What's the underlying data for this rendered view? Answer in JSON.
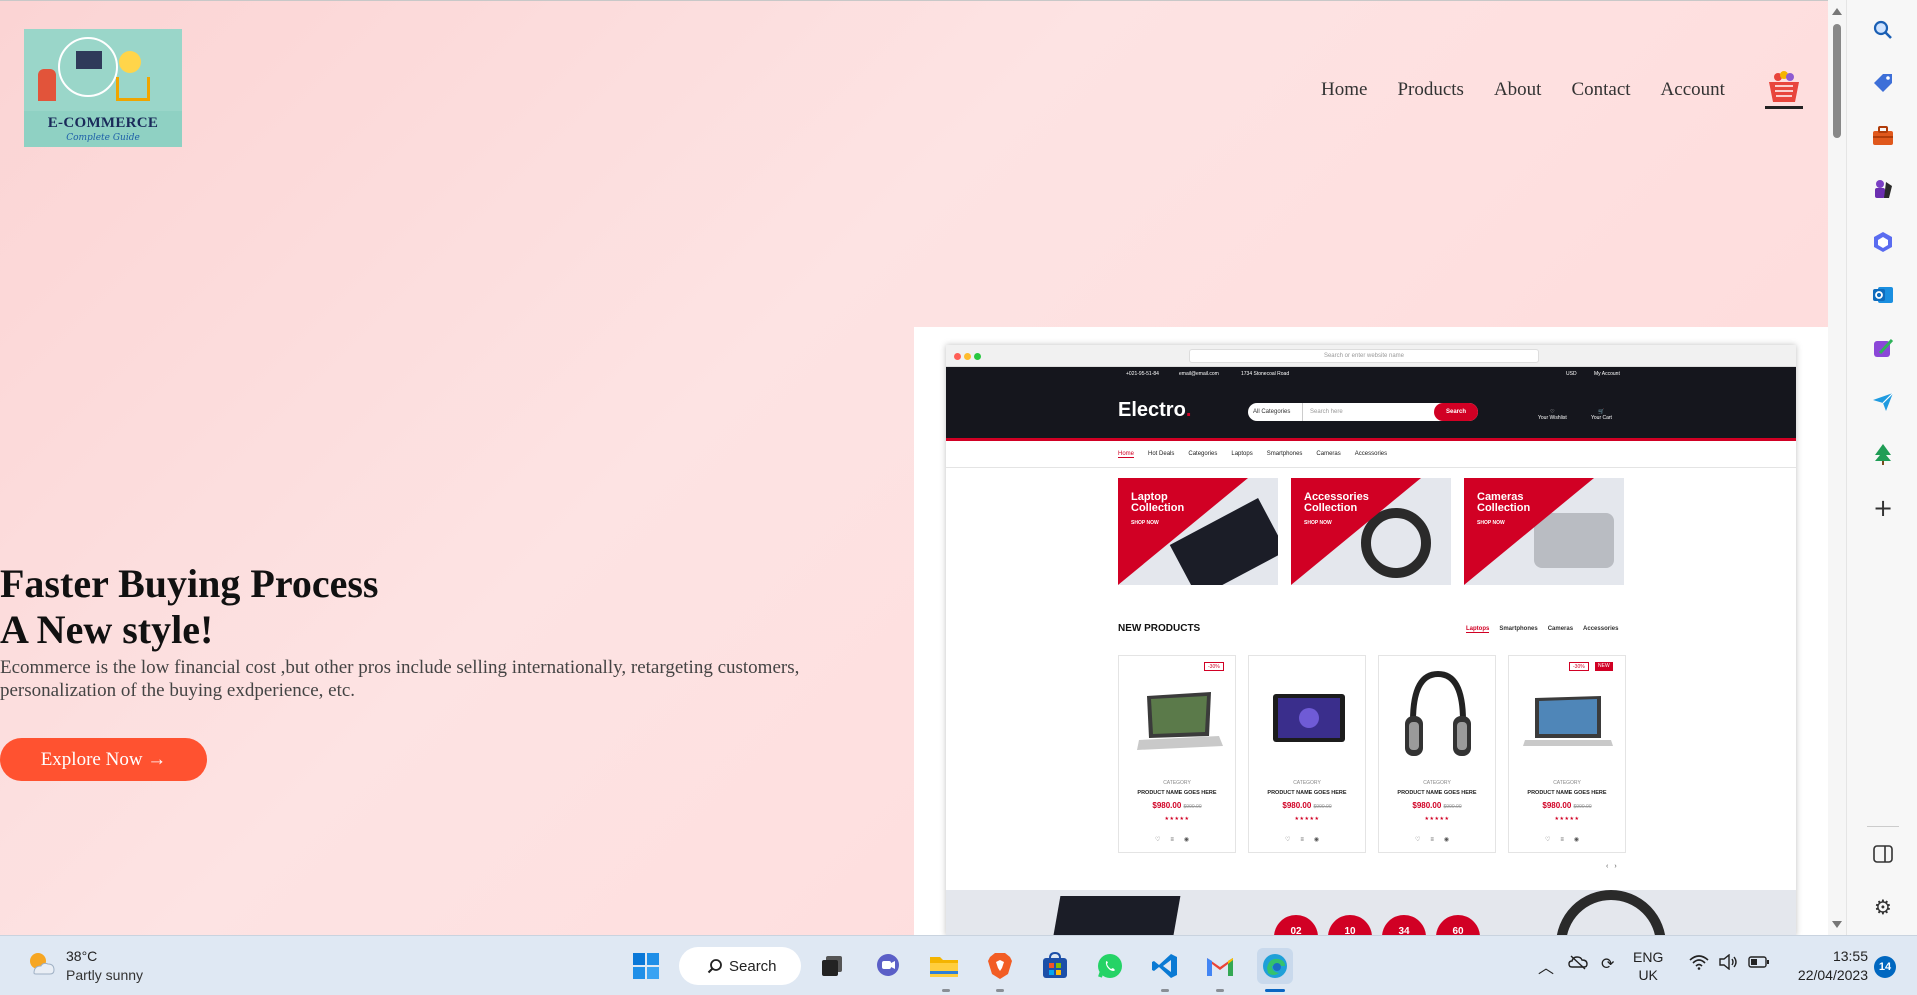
{
  "site": {
    "logo": {
      "title": "E-COMMERCE",
      "subtitle": "Complete Guide"
    },
    "nav": [
      {
        "label": "Home"
      },
      {
        "label": "Products"
      },
      {
        "label": "About"
      },
      {
        "label": "Contact"
      },
      {
        "label": "Account"
      }
    ],
    "hero": {
      "title_line1": "Faster Buying Process",
      "title_line2": "A New style!",
      "description": "Ecommerce is the low financial cost ,but other pros include selling internationally, retargeting customers, personalization of the buying exdperience, etc.",
      "button_label": "Explore Now →"
    },
    "preview": {
      "url_placeholder": "Search or enter website name",
      "topbar": {
        "phone": "+021-95-51-84",
        "email": "email@email.com",
        "address": "1734 Stonecoal Road",
        "currency": "USD",
        "account": "My Account"
      },
      "brand": "Electro",
      "brand_dot": ".",
      "search": {
        "category": "All Categories",
        "placeholder": "Search here",
        "button": "Search"
      },
      "wishlist_label": "Your Wishlist",
      "cart_label": "Your Cart",
      "nav": [
        "Home",
        "Hot Deals",
        "Categories",
        "Laptops",
        "Smartphones",
        "Cameras",
        "Accessories"
      ],
      "banners": [
        {
          "title_l1": "Laptop",
          "title_l2": "Collection",
          "shop": "SHOP NOW"
        },
        {
          "title_l1": "Accessories",
          "title_l2": "Collection",
          "shop": "SHOP NOW"
        },
        {
          "title_l1": "Cameras",
          "title_l2": "Collection",
          "shop": "SHOP NOW"
        }
      ],
      "new_products": "NEW PRODUCTS",
      "tabs": [
        "Laptops",
        "Smartphones",
        "Cameras",
        "Accessories"
      ],
      "products": [
        {
          "category": "CATEGORY",
          "name": "PRODUCT NAME GOES HERE",
          "price": "$980.00",
          "old_price": "$990.00",
          "tag1": "-30%",
          "tag2": ""
        },
        {
          "category": "CATEGORY",
          "name": "PRODUCT NAME GOES HERE",
          "price": "$980.00",
          "old_price": "$990.00",
          "tag1": "",
          "tag2": ""
        },
        {
          "category": "CATEGORY",
          "name": "PRODUCT NAME GOES HERE",
          "price": "$980.00",
          "old_price": "$990.00",
          "tag1": "",
          "tag2": ""
        },
        {
          "category": "CATEGORY",
          "name": "PRODUCT NAME GOES HERE",
          "price": "$980.00",
          "old_price": "$990.00",
          "tag1": "-30%",
          "tag2": "NEW"
        }
      ],
      "countdown": [
        "02",
        "10",
        "34",
        "60"
      ]
    }
  },
  "sidebar_icons": [
    "search-icon",
    "tag-icon",
    "briefcase-icon",
    "chess-icon",
    "copilot-icon",
    "outlook-icon",
    "designer-icon",
    "send-icon",
    "tree-icon",
    "plus-icon",
    "panel-icon",
    "gear-icon"
  ],
  "taskbar": {
    "weather_temp": "38°C",
    "weather_desc": "Partly sunny",
    "search_label": "Search",
    "lang_line1": "ENG",
    "lang_line2": "UK",
    "time": "13:55",
    "date": "22/04/2023",
    "notification_count": "14"
  },
  "colors": {
    "hero_button": "#ff5230",
    "brand_red": "#d10024",
    "taskbar": "#dfe8f3"
  }
}
